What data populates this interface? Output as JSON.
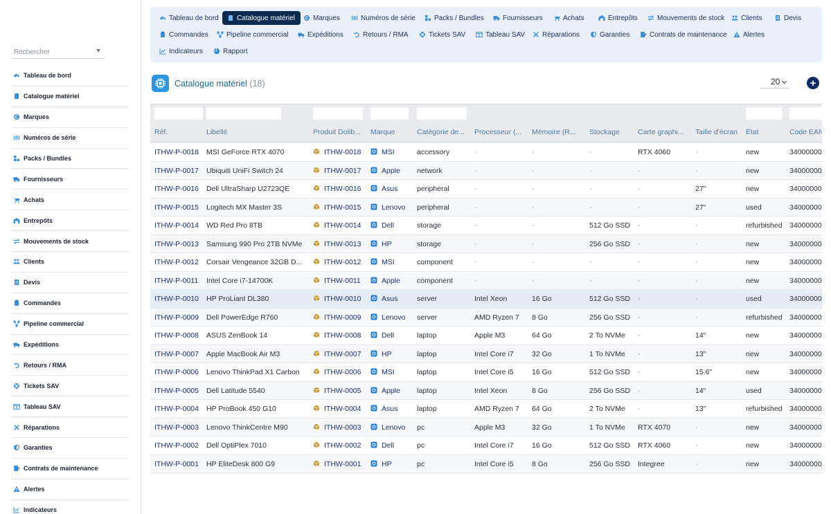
{
  "sidebar": {
    "search_placeholder": "Rechercher",
    "items": [
      {
        "label": "Tableau de bord",
        "icon": "dashboard-icon"
      },
      {
        "label": "Catalogue matériel",
        "icon": "file-icon"
      },
      {
        "label": "Marques",
        "icon": "copyright-icon"
      },
      {
        "label": "Numéros de série",
        "icon": "barcode-icon"
      },
      {
        "label": "Packs / Bundles",
        "icon": "puzzle-icon"
      },
      {
        "label": "Fournisseurs",
        "icon": "truck-icon"
      },
      {
        "label": "Achats",
        "icon": "cart-icon"
      },
      {
        "label": "Entrepôts",
        "icon": "warehouse-icon"
      },
      {
        "label": "Mouvements de stock",
        "icon": "exchange-icon"
      },
      {
        "label": "Clients",
        "icon": "users-icon"
      },
      {
        "label": "Devis",
        "icon": "document-icon"
      },
      {
        "label": "Commandes",
        "icon": "clipboard-icon"
      },
      {
        "label": "Pipeline commercial",
        "icon": "diagram-icon"
      },
      {
        "label": "Expéditions",
        "icon": "shipping-icon"
      },
      {
        "label": "Retours / RMA",
        "icon": "undo-icon"
      },
      {
        "label": "Tickets SAV",
        "icon": "lifebuoy-icon"
      },
      {
        "label": "Tableau SAV",
        "icon": "board-icon"
      },
      {
        "label": "Réparations",
        "icon": "tools-icon"
      },
      {
        "label": "Garanties",
        "icon": "shield-icon"
      },
      {
        "label": "Contrats de maintenance",
        "icon": "contract-icon"
      },
      {
        "label": "Alertes",
        "icon": "warning-icon"
      },
      {
        "label": "Indicateurs",
        "icon": "chart-icon"
      }
    ]
  },
  "topmenu": {
    "active": "Catalogue matériel",
    "items": [
      "Tableau de bord",
      "Catalogue matériel",
      "Marques",
      "Numéros de série",
      "Packs / Bundles",
      "Fournisseurs",
      "Achats",
      "Entrepôts",
      "Mouvements de stock",
      "Clients",
      "Devis",
      "Commandes",
      "Pipeline commercial",
      "Expéditions",
      "Retours / RMA",
      "Tickets SAV",
      "Tableau SAV",
      "Réparations",
      "Garanties",
      "Contrats de maintenance",
      "Alertes",
      "Indicateurs",
      "Rapport"
    ]
  },
  "page": {
    "title": "Catalogue matériel",
    "count": "(18)",
    "page_size": "20",
    "add_button": "+"
  },
  "table": {
    "columns": [
      "Réf.",
      "Libellé",
      "Produit Dolib...",
      "Marque",
      "Catégorie de...",
      "Processeur (...",
      "Mémoire (R...",
      "Stockage",
      "Carte graphi...",
      "Taille d'écran",
      "État",
      "Code EAN"
    ],
    "rows": [
      [
        "ITHW-P-0018",
        "MSI GeForce RTX 4070",
        "ITHW-0018",
        "MSI",
        "accessory",
        "-",
        "-",
        "-",
        "RTX 4060",
        "-",
        "new",
        "34000000"
      ],
      [
        "ITHW-P-0017",
        "Ubiquiti UniFi Switch 24",
        "ITHW-0017",
        "Apple",
        "network",
        "-",
        "-",
        "-",
        "-",
        "-",
        "new",
        "34000000"
      ],
      [
        "ITHW-P-0016",
        "Dell UltraSharp U2723QE",
        "ITHW-0016",
        "Asus",
        "peripheral",
        "-",
        "-",
        "-",
        "-",
        "27\"",
        "new",
        "34000000"
      ],
      [
        "ITHW-P-0015",
        "Logitech MX Master 3S",
        "ITHW-0015",
        "Lenovo",
        "peripheral",
        "-",
        "-",
        "-",
        "-",
        "27\"",
        "used",
        "34000000"
      ],
      [
        "ITHW-P-0014",
        "WD Red Pro 8TB",
        "ITHW-0014",
        "Dell",
        "storage",
        "-",
        "-",
        "512 Go SSD",
        "-",
        "-",
        "refurbished",
        "34000000"
      ],
      [
        "ITHW-P-0013",
        "Samsung 990 Pro 2TB NVMe",
        "ITHW-0013",
        "HP",
        "storage",
        "-",
        "-",
        "256 Go SSD",
        "-",
        "-",
        "new",
        "34000000"
      ],
      [
        "ITHW-P-0012",
        "Corsair Vengeance 32GB D...",
        "ITHW-0012",
        "MSI",
        "component",
        "-",
        "-",
        "-",
        "-",
        "-",
        "new",
        "34000000"
      ],
      [
        "ITHW-P-0011",
        "Intel Core i7-14700K",
        "ITHW-0011",
        "Apple",
        "component",
        "-",
        "-",
        "-",
        "-",
        "-",
        "new",
        "34000000"
      ],
      [
        "ITHW-P-0010",
        "HP ProLiant DL380",
        "ITHW-0010",
        "Asus",
        "server",
        "Intel Xeon",
        "16 Go",
        "512 Go SSD",
        "-",
        "-",
        "used",
        "34000000"
      ],
      [
        "ITHW-P-0009",
        "Dell PowerEdge R760",
        "ITHW-0009",
        "Lenovo",
        "server",
        "AMD Ryzen 7",
        "8 Go",
        "256 Go SSD",
        "-",
        "-",
        "refurbished",
        "34000000"
      ],
      [
        "ITHW-P-0008",
        "ASUS ZenBook 14",
        "ITHW-0008",
        "Dell",
        "laptop",
        "Apple M3",
        "64 Go",
        "2 To NVMe",
        "-",
        "14\"",
        "new",
        "34000000"
      ],
      [
        "ITHW-P-0007",
        "Apple MacBook Air M3",
        "ITHW-0007",
        "HP",
        "laptop",
        "Intel Core i7",
        "32 Go",
        "1 To NVMe",
        "-",
        "13\"",
        "new",
        "34000000"
      ],
      [
        "ITHW-P-0006",
        "Lenovo ThinkPad X1 Carbon",
        "ITHW-0006",
        "MSI",
        "laptop",
        "Intel Core i5",
        "16 Go",
        "512 Go SSD",
        "-",
        "15.6\"",
        "new",
        "34000000"
      ],
      [
        "ITHW-P-0005",
        "Dell Latitude 5540",
        "ITHW-0005",
        "Apple",
        "laptop",
        "Intel Xeon",
        "8 Go",
        "256 Go SSD",
        "-",
        "14\"",
        "used",
        "34000000"
      ],
      [
        "ITHW-P-0004",
        "HP ProBook 450 G10",
        "ITHW-0004",
        "Asus",
        "laptop",
        "AMD Ryzen 7",
        "64 Go",
        "2 To NVMe",
        "-",
        "13\"",
        "refurbished",
        "34000000"
      ],
      [
        "ITHW-P-0003",
        "Lenovo ThinkCentre M90",
        "ITHW-0003",
        "Lenovo",
        "pc",
        "Apple M3",
        "32 Go",
        "1 To NVMe",
        "RTX 4070",
        "-",
        "new",
        "34000000"
      ],
      [
        "ITHW-P-0002",
        "Dell OptiPlex 7010",
        "ITHW-0002",
        "Dell",
        "pc",
        "Intel Core i7",
        "16 Go",
        "512 Go SSD",
        "RTX 4060",
        "-",
        "new",
        "34000000"
      ],
      [
        "ITHW-P-0001",
        "HP EliteDesk 800 G9",
        "ITHW-0001",
        "HP",
        "pc",
        "Intel Core i5",
        "8 Go",
        "256 Go SSD",
        "Integree",
        "-",
        "new",
        "34000000"
      ]
    ],
    "highlighted_row": "ITHW-P-0010"
  },
  "colors": {
    "menu_bg": "#e9f0f9",
    "menu_active": "#0b2a4f",
    "link": "#1c2f6b",
    "header_text": "#4e7aa3",
    "product_icon": "#b9922f",
    "brand_icon": "#2b7fd4"
  }
}
